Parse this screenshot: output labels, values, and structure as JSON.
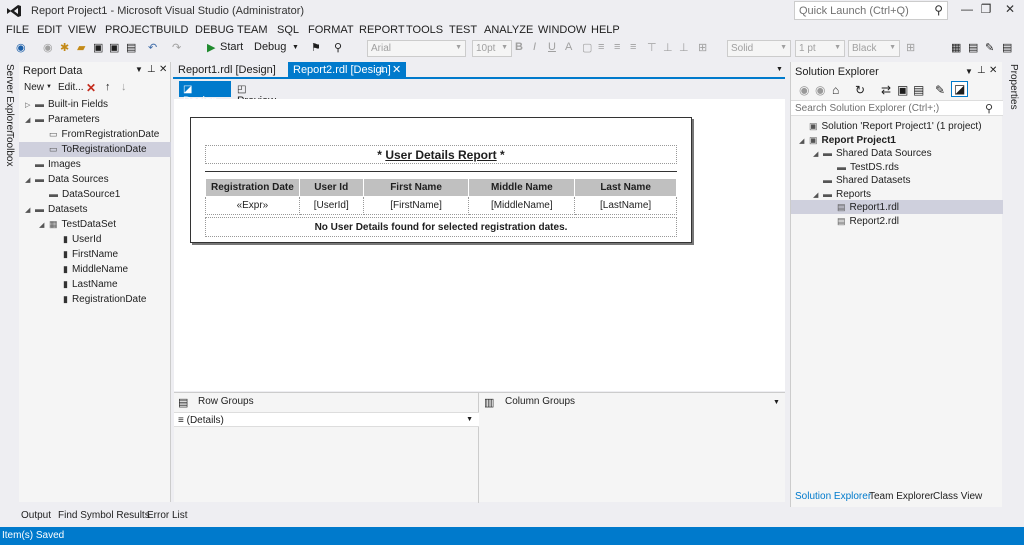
{
  "window": {
    "title": "Report Project1 - Microsoft Visual Studio (Administrator)",
    "quick_launch": "Quick Launch (Ctrl+Q)"
  },
  "menu": [
    "FILE",
    "EDIT",
    "VIEW",
    "PROJECT",
    "BUILD",
    "DEBUG",
    "TEAM",
    "SQL",
    "FORMAT",
    "REPORT",
    "TOOLS",
    "TEST",
    "ANALYZE",
    "WINDOW",
    "HELP"
  ],
  "toolbar": {
    "start": "Start",
    "config": "Debug",
    "font": "Arial",
    "size": "10pt",
    "line_style": "Solid",
    "line_width": "1 pt",
    "color": "Black"
  },
  "side_tabs": {
    "server_explorer": "Server Explorer",
    "toolbox": "Toolbox",
    "properties": "Properties"
  },
  "report_data": {
    "title": "Report Data",
    "new": "New",
    "edit": "Edit...",
    "items": [
      {
        "label": "Built-in Fields",
        "indent": 0,
        "expand": "right",
        "icon": "folder"
      },
      {
        "label": "Parameters",
        "indent": 0,
        "expand": "down",
        "icon": "folder"
      },
      {
        "label": "FromRegistrationDate",
        "indent": 1,
        "expand": "",
        "icon": "param"
      },
      {
        "label": "ToRegistrationDate",
        "indent": 1,
        "expand": "",
        "icon": "param",
        "selected": true
      },
      {
        "label": "Images",
        "indent": 0,
        "expand": "",
        "icon": "folder"
      },
      {
        "label": "Data Sources",
        "indent": 0,
        "expand": "down",
        "icon": "folder"
      },
      {
        "label": "DataSource1",
        "indent": 1,
        "expand": "",
        "icon": "datasource"
      },
      {
        "label": "Datasets",
        "indent": 0,
        "expand": "down",
        "icon": "folder"
      },
      {
        "label": "TestDataSet",
        "indent": 1,
        "expand": "down",
        "icon": "dataset"
      },
      {
        "label": "UserId",
        "indent": 2,
        "expand": "",
        "icon": "field"
      },
      {
        "label": "FirstName",
        "indent": 2,
        "expand": "",
        "icon": "field"
      },
      {
        "label": "MiddleName",
        "indent": 2,
        "expand": "",
        "icon": "field"
      },
      {
        "label": "LastName",
        "indent": 2,
        "expand": "",
        "icon": "field"
      },
      {
        "label": "RegistrationDate",
        "indent": 2,
        "expand": "",
        "icon": "field"
      }
    ]
  },
  "doc_tabs": [
    {
      "label": "Report1.rdl [Design]",
      "active": false
    },
    {
      "label": "Report2.rdl [Design]",
      "active": true
    }
  ],
  "view_tabs": {
    "design": "Design",
    "preview": "Preview"
  },
  "report": {
    "title_prefix": "* ",
    "title": "User Details Report",
    "title_suffix": " *",
    "headers": [
      "Registration Date",
      "User Id",
      "First Name",
      "Middle Name",
      "Last Name"
    ],
    "cells": [
      "«Expr»",
      "[UserId]",
      "[FirstName]",
      "[MiddleName]",
      "[LastName]"
    ],
    "empty_message": "No User Details found for selected registration dates."
  },
  "groups": {
    "row_title": "Row Groups",
    "col_title": "Column Groups",
    "row_detail": "≡ (Details)"
  },
  "solution_explorer": {
    "title": "Solution Explorer",
    "search": "Search Solution Explorer (Ctrl+;)",
    "items": [
      {
        "label": "Solution 'Report Project1' (1 project)",
        "indent": 0,
        "icon": "solution",
        "expand": ""
      },
      {
        "label": "Report Project1",
        "indent": 0,
        "icon": "project",
        "expand": "down",
        "bold": true
      },
      {
        "label": "Shared Data Sources",
        "indent": 1,
        "icon": "folder",
        "expand": "down"
      },
      {
        "label": "TestDS.rds",
        "indent": 2,
        "icon": "datasource",
        "expand": ""
      },
      {
        "label": "Shared Datasets",
        "indent": 1,
        "icon": "folder",
        "expand": ""
      },
      {
        "label": "Reports",
        "indent": 1,
        "icon": "folder",
        "expand": "down"
      },
      {
        "label": "Report1.rdl",
        "indent": 2,
        "icon": "report",
        "expand": "",
        "selected": true
      },
      {
        "label": "Report2.rdl",
        "indent": 2,
        "icon": "report",
        "expand": ""
      }
    ],
    "tabs": [
      "Solution Explorer",
      "Team Explorer",
      "Class View"
    ]
  },
  "bottom_tabs": [
    "Output",
    "Find Symbol Results",
    "Error List"
  ],
  "status": "Item(s) Saved",
  "colors": {
    "accent": "#007acc",
    "selection": "#cfd0dd",
    "header_cell": "#c0c0c0"
  }
}
